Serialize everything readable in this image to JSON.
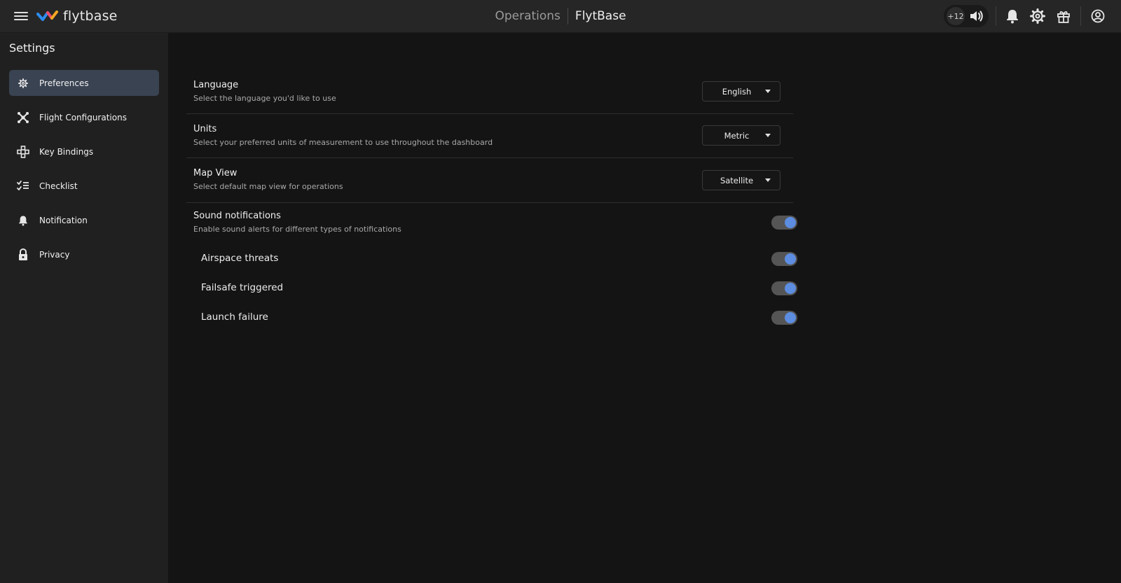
{
  "header": {
    "brand_name": "flytbase",
    "section": "Operations",
    "organization": "FlytBase",
    "volume_badge": "+12"
  },
  "sidebar": {
    "title": "Settings",
    "items": [
      {
        "label": "Preferences",
        "icon": "gear-icon",
        "active": true
      },
      {
        "label": "Flight Configurations",
        "icon": "drone-icon",
        "active": false
      },
      {
        "label": "Key Bindings",
        "icon": "key-bindings-icon",
        "active": false
      },
      {
        "label": "Checklist",
        "icon": "checklist-icon",
        "active": false
      },
      {
        "label": "Notification",
        "icon": "bell-icon",
        "active": false
      },
      {
        "label": "Privacy",
        "icon": "lock-icon",
        "active": false
      }
    ]
  },
  "settings": {
    "language": {
      "title": "Language",
      "description": "Select the language you'd like to use",
      "value": "English"
    },
    "units": {
      "title": "Units",
      "description": "Select your preferred units of measurement to use throughout the dashboard",
      "value": "Metric"
    },
    "map_view": {
      "title": "Map View",
      "description": "Select default map view for operations",
      "value": "Satellite"
    },
    "sound": {
      "title": "Sound notifications",
      "description": "Enable sound alerts for different types of notifications",
      "enabled": true,
      "sub_items": [
        {
          "label": "Airspace threats",
          "enabled": true
        },
        {
          "label": "Failsafe triggered",
          "enabled": true
        },
        {
          "label": "Launch failure",
          "enabled": true
        }
      ]
    }
  },
  "colors": {
    "accent": "#5c8de0",
    "active_nav": "#3a4352",
    "topbar": "#262626",
    "sidebar": "#202020",
    "background": "#141414"
  }
}
